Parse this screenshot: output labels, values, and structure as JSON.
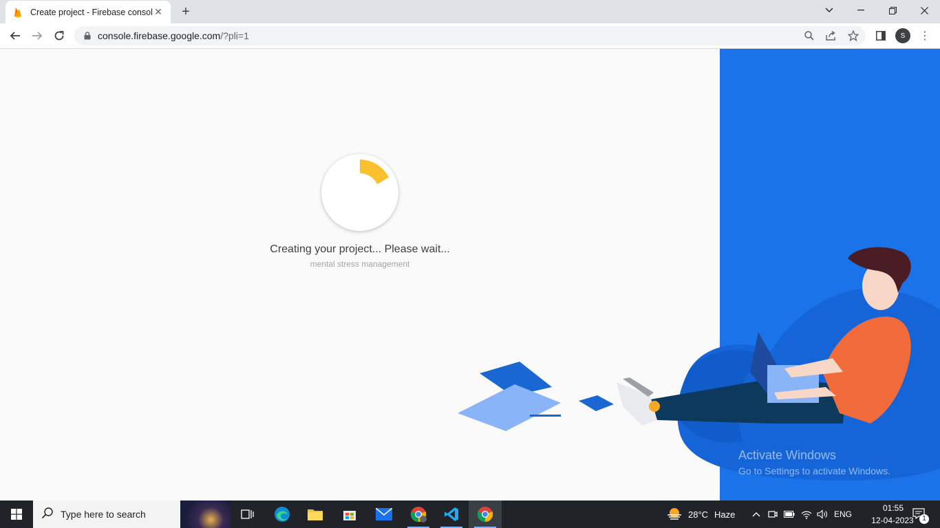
{
  "browser": {
    "tab_title": "Create project - Firebase console",
    "url_host": "console.firebase.google.com",
    "url_path": "/?pli=1",
    "profile_initial": "S"
  },
  "page": {
    "status_title": "Creating your project... Please wait...",
    "project_name": "mental stress management",
    "watermark_title": "Activate Windows",
    "watermark_subtitle": "Go to Settings to activate Windows.",
    "colors": {
      "accent_blue": "#1a73e8",
      "spinner_yellow": "#fbc02d"
    }
  },
  "taskbar": {
    "search_placeholder": "Type here to search",
    "weather_temp": "28°C",
    "weather_desc": "Haze",
    "language": "ENG",
    "time": "01:55",
    "date": "12-04-2023",
    "notification_count": "1"
  }
}
